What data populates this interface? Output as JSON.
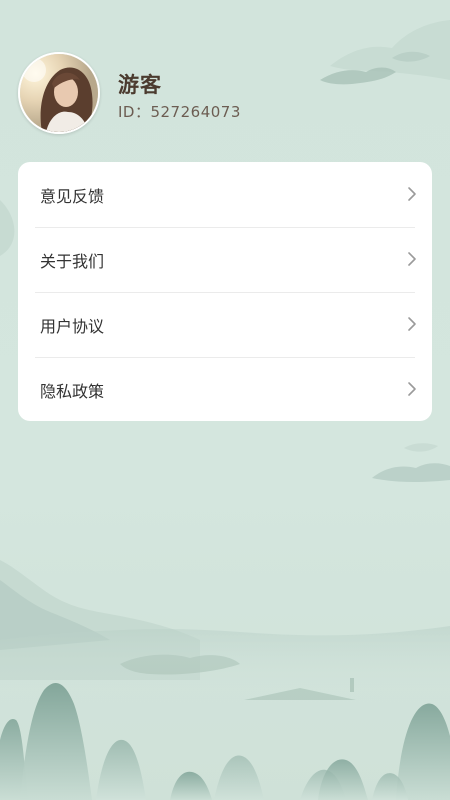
{
  "profile": {
    "name": "游客",
    "id_text": "ID：527264073"
  },
  "menu": {
    "items": [
      {
        "label": "意见反馈"
      },
      {
        "label": "关于我们"
      },
      {
        "label": "用户协议"
      },
      {
        "label": "隐私政策"
      }
    ]
  },
  "icons": {
    "menu_arrow": "chevron-right-icon"
  },
  "colors": {
    "background": "#d4e5dd",
    "card": "#ffffff",
    "name_text": "#4b3b2f",
    "id_text": "#6c5d52",
    "menu_text": "#333333",
    "chevron": "#9a9a9a"
  }
}
